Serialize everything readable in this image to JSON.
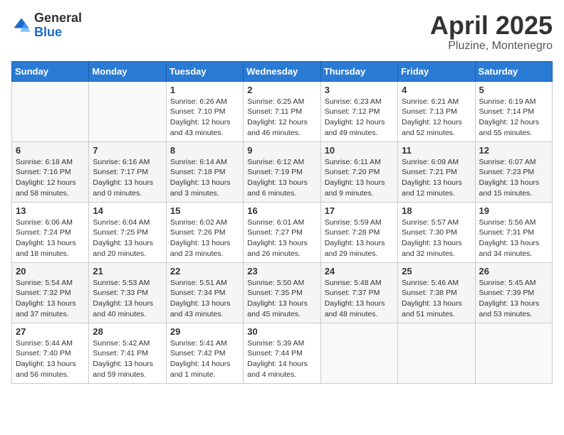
{
  "header": {
    "logo_general": "General",
    "logo_blue": "Blue",
    "month_title": "April 2025",
    "location": "Pluzine, Montenegro"
  },
  "days_of_week": [
    "Sunday",
    "Monday",
    "Tuesday",
    "Wednesday",
    "Thursday",
    "Friday",
    "Saturday"
  ],
  "weeks": [
    [
      {
        "day": "",
        "info": ""
      },
      {
        "day": "",
        "info": ""
      },
      {
        "day": "1",
        "info": "Sunrise: 6:26 AM\nSunset: 7:10 PM\nDaylight: 12 hours and 43 minutes."
      },
      {
        "day": "2",
        "info": "Sunrise: 6:25 AM\nSunset: 7:11 PM\nDaylight: 12 hours and 46 minutes."
      },
      {
        "day": "3",
        "info": "Sunrise: 6:23 AM\nSunset: 7:12 PM\nDaylight: 12 hours and 49 minutes."
      },
      {
        "day": "4",
        "info": "Sunrise: 6:21 AM\nSunset: 7:13 PM\nDaylight: 12 hours and 52 minutes."
      },
      {
        "day": "5",
        "info": "Sunrise: 6:19 AM\nSunset: 7:14 PM\nDaylight: 12 hours and 55 minutes."
      }
    ],
    [
      {
        "day": "6",
        "info": "Sunrise: 6:18 AM\nSunset: 7:16 PM\nDaylight: 12 hours and 58 minutes."
      },
      {
        "day": "7",
        "info": "Sunrise: 6:16 AM\nSunset: 7:17 PM\nDaylight: 13 hours and 0 minutes."
      },
      {
        "day": "8",
        "info": "Sunrise: 6:14 AM\nSunset: 7:18 PM\nDaylight: 13 hours and 3 minutes."
      },
      {
        "day": "9",
        "info": "Sunrise: 6:12 AM\nSunset: 7:19 PM\nDaylight: 13 hours and 6 minutes."
      },
      {
        "day": "10",
        "info": "Sunrise: 6:11 AM\nSunset: 7:20 PM\nDaylight: 13 hours and 9 minutes."
      },
      {
        "day": "11",
        "info": "Sunrise: 6:09 AM\nSunset: 7:21 PM\nDaylight: 13 hours and 12 minutes."
      },
      {
        "day": "12",
        "info": "Sunrise: 6:07 AM\nSunset: 7:23 PM\nDaylight: 13 hours and 15 minutes."
      }
    ],
    [
      {
        "day": "13",
        "info": "Sunrise: 6:06 AM\nSunset: 7:24 PM\nDaylight: 13 hours and 18 minutes."
      },
      {
        "day": "14",
        "info": "Sunrise: 6:04 AM\nSunset: 7:25 PM\nDaylight: 13 hours and 20 minutes."
      },
      {
        "day": "15",
        "info": "Sunrise: 6:02 AM\nSunset: 7:26 PM\nDaylight: 13 hours and 23 minutes."
      },
      {
        "day": "16",
        "info": "Sunrise: 6:01 AM\nSunset: 7:27 PM\nDaylight: 13 hours and 26 minutes."
      },
      {
        "day": "17",
        "info": "Sunrise: 5:59 AM\nSunset: 7:28 PM\nDaylight: 13 hours and 29 minutes."
      },
      {
        "day": "18",
        "info": "Sunrise: 5:57 AM\nSunset: 7:30 PM\nDaylight: 13 hours and 32 minutes."
      },
      {
        "day": "19",
        "info": "Sunrise: 5:56 AM\nSunset: 7:31 PM\nDaylight: 13 hours and 34 minutes."
      }
    ],
    [
      {
        "day": "20",
        "info": "Sunrise: 5:54 AM\nSunset: 7:32 PM\nDaylight: 13 hours and 37 minutes."
      },
      {
        "day": "21",
        "info": "Sunrise: 5:53 AM\nSunset: 7:33 PM\nDaylight: 13 hours and 40 minutes."
      },
      {
        "day": "22",
        "info": "Sunrise: 5:51 AM\nSunset: 7:34 PM\nDaylight: 13 hours and 43 minutes."
      },
      {
        "day": "23",
        "info": "Sunrise: 5:50 AM\nSunset: 7:35 PM\nDaylight: 13 hours and 45 minutes."
      },
      {
        "day": "24",
        "info": "Sunrise: 5:48 AM\nSunset: 7:37 PM\nDaylight: 13 hours and 48 minutes."
      },
      {
        "day": "25",
        "info": "Sunrise: 5:46 AM\nSunset: 7:38 PM\nDaylight: 13 hours and 51 minutes."
      },
      {
        "day": "26",
        "info": "Sunrise: 5:45 AM\nSunset: 7:39 PM\nDaylight: 13 hours and 53 minutes."
      }
    ],
    [
      {
        "day": "27",
        "info": "Sunrise: 5:44 AM\nSunset: 7:40 PM\nDaylight: 13 hours and 56 minutes."
      },
      {
        "day": "28",
        "info": "Sunrise: 5:42 AM\nSunset: 7:41 PM\nDaylight: 13 hours and 59 minutes."
      },
      {
        "day": "29",
        "info": "Sunrise: 5:41 AM\nSunset: 7:42 PM\nDaylight: 14 hours and 1 minute."
      },
      {
        "day": "30",
        "info": "Sunrise: 5:39 AM\nSunset: 7:44 PM\nDaylight: 14 hours and 4 minutes."
      },
      {
        "day": "",
        "info": ""
      },
      {
        "day": "",
        "info": ""
      },
      {
        "day": "",
        "info": ""
      }
    ]
  ]
}
